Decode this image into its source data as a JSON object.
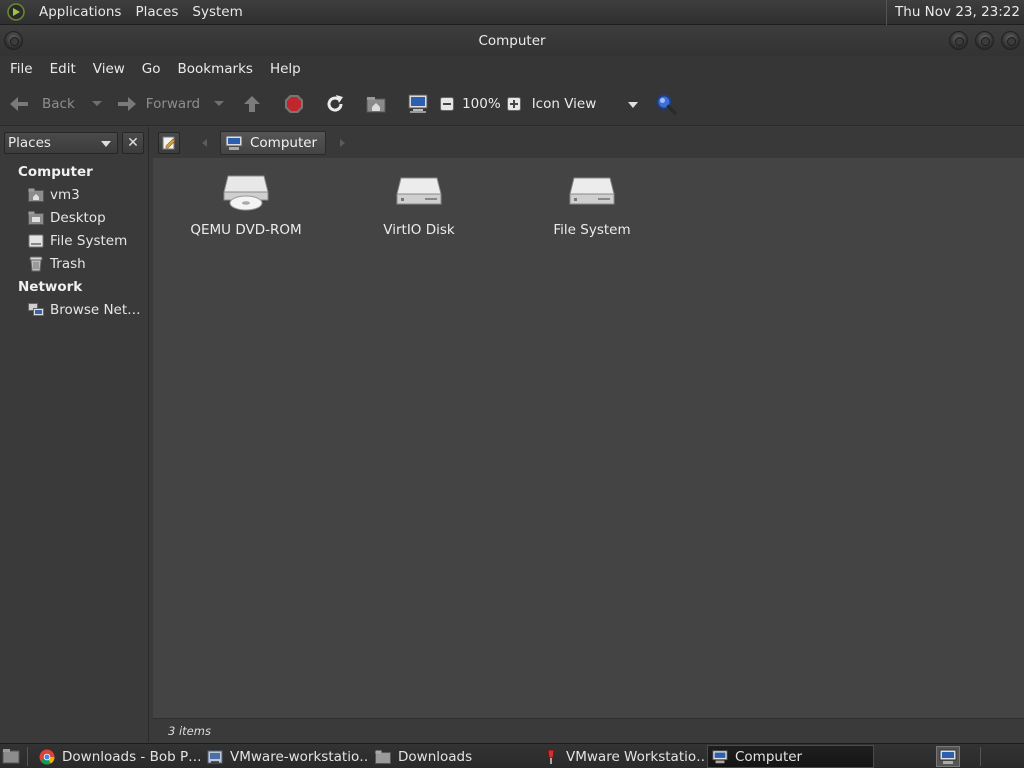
{
  "top_panel": {
    "menus": [
      "Applications",
      "Places",
      "System"
    ],
    "clock": "Thu Nov 23, 23:22"
  },
  "window": {
    "title": "Computer"
  },
  "menubar": [
    "File",
    "Edit",
    "View",
    "Go",
    "Bookmarks",
    "Help"
  ],
  "toolbar": {
    "back_label": "Back",
    "forward_label": "Forward",
    "zoom": "100%",
    "view_mode": "Icon View",
    "icons": [
      "up-icon",
      "stop-icon",
      "reload-icon",
      "home-icon",
      "computer-icon",
      "zoom-out-icon",
      "zoom-in-icon",
      "search-icon"
    ]
  },
  "sidebar": {
    "selector": "Places",
    "sections": [
      {
        "title": "Computer",
        "items": [
          {
            "label": "vm3",
            "icon": "home-folder-icon"
          },
          {
            "label": "Desktop",
            "icon": "desktop-folder-icon"
          },
          {
            "label": "File System",
            "icon": "drive-icon"
          },
          {
            "label": "Trash",
            "icon": "trash-icon"
          }
        ]
      },
      {
        "title": "Network",
        "items": [
          {
            "label": "Browse Net…",
            "icon": "network-icon"
          }
        ]
      }
    ]
  },
  "location": {
    "crumb": "Computer"
  },
  "files": [
    {
      "name": "QEMU DVD-ROM",
      "icon": "optical-drive-icon"
    },
    {
      "name": "VirtIO Disk",
      "icon": "hard-disk-icon"
    },
    {
      "name": "File System",
      "icon": "hard-disk-icon"
    }
  ],
  "status": "3 items",
  "taskbar": {
    "tasks": [
      {
        "label": "Downloads - Bob P…",
        "icon": "chrome-icon"
      },
      {
        "label": "VMware-workstatio…",
        "icon": "installer-icon"
      },
      {
        "label": "Downloads",
        "icon": "folder-icon"
      },
      {
        "label": "VMware Workstatio…",
        "icon": "vmware-icon"
      },
      {
        "label": "Computer",
        "icon": "computer-icon",
        "active": true
      }
    ]
  },
  "colors": {
    "panel": "#2f2f2f",
    "content": "#444444",
    "sidebar": "#3a3a3a",
    "stop_red": "#c0262b",
    "search_blue": "#3d6fd6"
  }
}
